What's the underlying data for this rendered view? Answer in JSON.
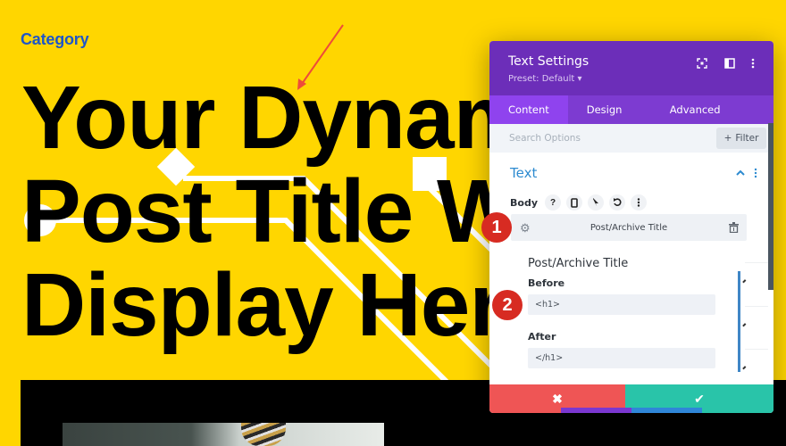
{
  "page": {
    "category": "Category",
    "headline_lines": [
      "Your Dynamic",
      "Post Title Will",
      "Display Here"
    ]
  },
  "panel": {
    "title": "Text Settings",
    "preset": "Preset: Default",
    "header_icons": [
      "focus-icon",
      "split-view-icon",
      "more-vertical-icon"
    ],
    "tabs": [
      {
        "label": "Content",
        "active": true
      },
      {
        "label": "Design",
        "active": false
      },
      {
        "label": "Advanced",
        "active": false
      }
    ],
    "search_placeholder": "Search Options",
    "filter_label": "Filter",
    "section_title": "Text",
    "body_label": "Body",
    "body_tools": [
      "help-icon",
      "mobile-icon",
      "pointer-icon",
      "undo-icon",
      "more-vertical-icon"
    ],
    "dynamic_content": {
      "label": "Post/Archive Title"
    },
    "sub_settings": {
      "title": "Post/Archive Title",
      "before_label": "Before",
      "before_value": "<h1>",
      "after_label": "After",
      "after_value": "</h1>"
    },
    "footer": {
      "cancel_icon": "✖",
      "save_icon": "✔"
    }
  },
  "annotations": {
    "badge_1": "1",
    "badge_2": "2"
  },
  "colors": {
    "page_bg": "#ffd600",
    "category": "#1e56c8",
    "header_purple": "#6c2eb9",
    "tab_purple": "#7d3bd1",
    "tab_active": "#8f43ee",
    "section_blue": "#2e8bd0",
    "cancel_red": "#ef5555",
    "save_green": "#29c4a9",
    "badge_red": "#d72b22"
  }
}
